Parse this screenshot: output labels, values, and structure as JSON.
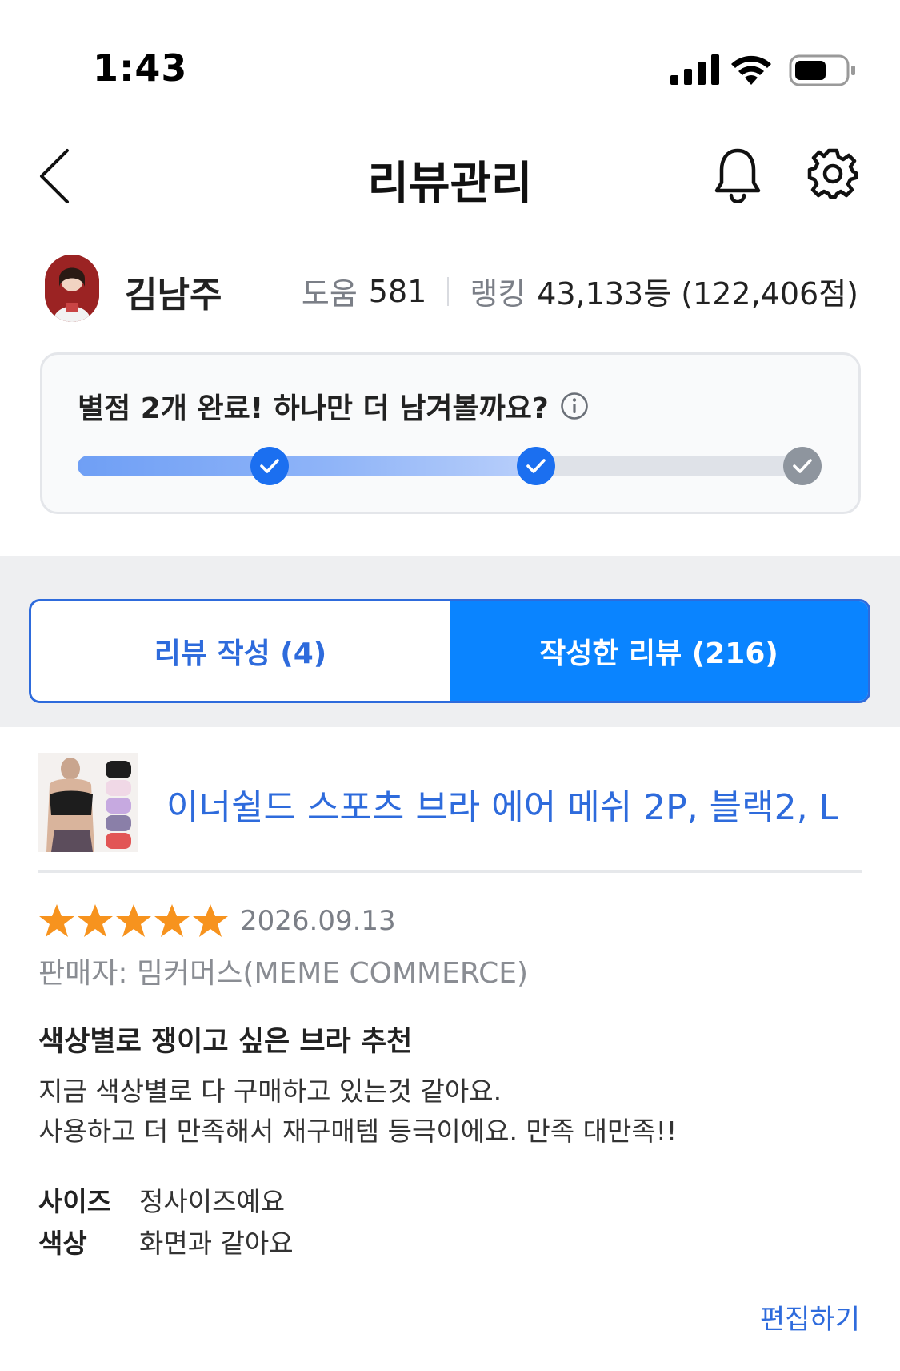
{
  "status_bar": {
    "time": "1:43"
  },
  "nav": {
    "title": "리뷰관리"
  },
  "profile": {
    "name": "김남주",
    "help_label": "도움",
    "help_value": "581",
    "rank_label": "랭킹",
    "rank_value": "43,133등 (122,406점)"
  },
  "progress": {
    "title": "별점 2개 완료! 하나만 더 남겨볼까요?",
    "completed": 2,
    "total": 3
  },
  "tabs": [
    {
      "label": "리뷰 작성 (4)",
      "active": false
    },
    {
      "label": "작성한 리뷰 (216)",
      "active": true
    }
  ],
  "product": {
    "name": "이너쉴드 스포츠 브라 에어 메쉬 2P, 블랙2, L"
  },
  "review": {
    "rating": 5,
    "date": "2026.09.13",
    "seller": "판매자: 밈커머스(MEME COMMERCE)",
    "title": "색상별로 쟁이고 싶은 브라 추천",
    "body_line1": "지금 색상별로 다 구매하고 있는것 같아요.",
    "body_line2": "사용하고 더 만족해서 재구매템 등극이에요. 만족 대만족!!",
    "attributes": [
      {
        "label": "사이즈",
        "value": "정사이즈예요"
      },
      {
        "label": "색상",
        "value": "화면과 같아요"
      }
    ],
    "edit_label": "편집하기"
  },
  "colors": {
    "accent": "#0a84ff",
    "link_blue": "#2e6bdc",
    "star": "#f7931e",
    "progress_check": "#1b6ff0"
  }
}
